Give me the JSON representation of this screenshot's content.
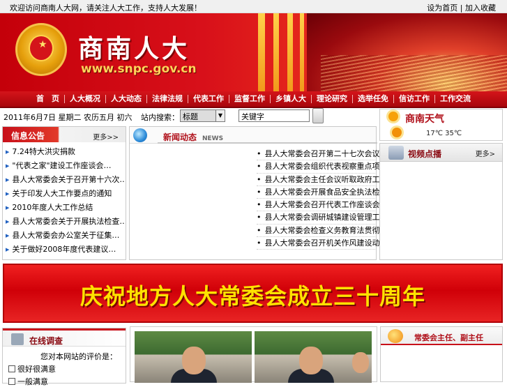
{
  "topbar": {
    "marquee": "欢迎访问商南人大网，请关注人大工作，支持人大发展！",
    "links": [
      "设为首页",
      "加入收藏"
    ]
  },
  "header": {
    "title": "商南人大",
    "url": "www.snpc.gov.cn"
  },
  "nav": {
    "items": [
      "首　页",
      "人大概况",
      "人大动态",
      "法律法规",
      "代表工作",
      "监督工作",
      "乡镇人大",
      "理论研究",
      "选举任免",
      "信访工作",
      "工作交流"
    ]
  },
  "infobar": {
    "date": "2011年6月7日 星期二 农历五月 初六",
    "search_label": "站内搜索：",
    "search_scope": "标题",
    "search_value": "关键字"
  },
  "notice": {
    "title": "信息公告",
    "more": "更多>>",
    "items": [
      "7.24特大洪灾捐款",
      "\"代表之家\"建设工作座谈会…",
      "县人大常委会关于召开第十六次…",
      "关于印发人大工作要点的通知",
      "2010年度人大工作总结",
      "县人大常委会关于开展执法检查…",
      "县人大常委会办公室关于征集…",
      "关于做好2008年度代表建议…"
    ]
  },
  "news": {
    "title": "新闻动态",
    "subtitle": "NEWS",
    "items": [
      "县人大常委会召开第二十七次会议…",
      "县人大常委会组织代表视察重点项…",
      "县人大常委会主任会议听取政府工…",
      "县人大常委会开展食品安全执法检…",
      "县人大常委会召开代表工作座谈会…",
      "县人大常委会调研城镇建设管理工…",
      "县人大常委会检查义务教育法贯彻…",
      "县人大常委会召开机关作风建设动…"
    ]
  },
  "weather": {
    "title": "商南天气",
    "temp": "17℃ 35℃"
  },
  "video": {
    "title": "视频点播",
    "more": "更多>"
  },
  "banner": {
    "text": "庆祝地方人大常委会成立三十周年"
  },
  "survey": {
    "title": "在线调查",
    "question": "您对本网站的评价是：",
    "options": [
      "很好很满意",
      "一般满意"
    ]
  },
  "leaders": {
    "title": "常委会主任、副主任"
  },
  "colors": {
    "brand_red": "#c8101a",
    "banner_yellow": "#ffe200"
  }
}
